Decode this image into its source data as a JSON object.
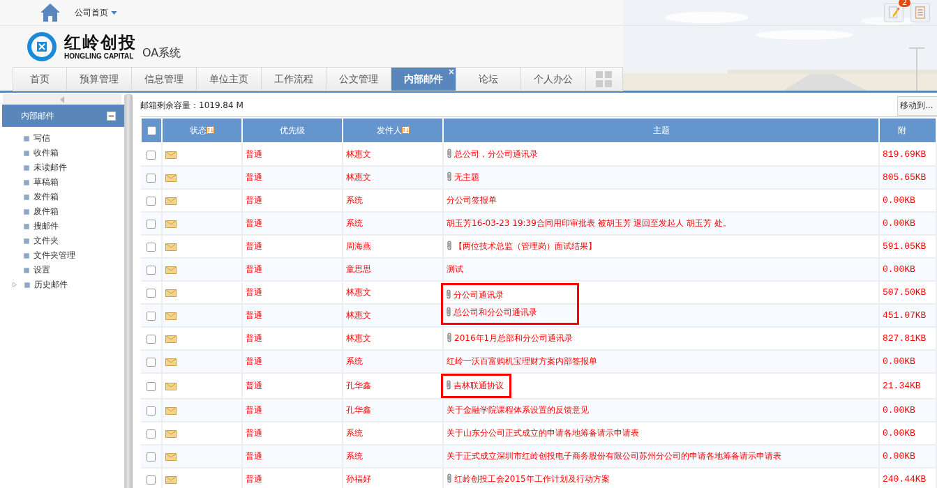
{
  "top_bar": {
    "home_menu": "公司首页",
    "notification_count": "2"
  },
  "brand": {
    "name": "红岭创投",
    "subtitle": "HONGLING CAPITAL",
    "system": "OA系统"
  },
  "tabs": [
    {
      "label": "首页",
      "selected": false
    },
    {
      "label": "预算管理",
      "selected": false
    },
    {
      "label": "信息管理",
      "selected": false
    },
    {
      "label": "单位主页",
      "selected": false
    },
    {
      "label": "工作流程",
      "selected": false
    },
    {
      "label": "公文管理",
      "selected": false
    },
    {
      "label": "内部邮件",
      "selected": true
    },
    {
      "label": "论坛",
      "selected": false
    },
    {
      "label": "个人办公",
      "selected": false
    }
  ],
  "sidebar": {
    "title": "内部邮件",
    "collapsed": false,
    "items": [
      {
        "label": "写信"
      },
      {
        "label": "收件箱"
      },
      {
        "label": "未读邮件"
      },
      {
        "label": "草稿箱"
      },
      {
        "label": "发件箱"
      },
      {
        "label": "废件箱"
      },
      {
        "label": "搜邮件"
      },
      {
        "label": "文件夹"
      },
      {
        "label": "文件夹管理"
      },
      {
        "label": "设置"
      },
      {
        "label": "历史邮件",
        "expanded": false
      }
    ]
  },
  "mailbox": {
    "capacity": "邮箱剩余容量：1019.84 M",
    "move_to": "移动到..."
  },
  "table": {
    "select_all_checked": false,
    "columns": [
      {
        "label": "状态",
        "sortable": true
      },
      {
        "label": "优先级",
        "sortable": false
      },
      {
        "label": "发件人",
        "sortable": true
      },
      {
        "label": "主题",
        "sortable": false
      },
      {
        "label": "附",
        "sortable": false
      }
    ],
    "rows": [
      {
        "checked": false,
        "priority": "普通",
        "sender": "林惠文",
        "attachment": true,
        "subject": "总公司，分公司通讯录",
        "size": "819.69KB",
        "marked": false
      },
      {
        "checked": false,
        "priority": "普通",
        "sender": "林惠文",
        "attachment": true,
        "subject": "无主题",
        "size": "805.65KB",
        "marked": false
      },
      {
        "checked": false,
        "priority": "普通",
        "sender": "系统",
        "attachment": false,
        "subject": "分公司签报单",
        "size": "0.00KB",
        "marked": false
      },
      {
        "checked": false,
        "priority": "普通",
        "sender": "系统",
        "attachment": false,
        "subject": "胡玉芳16-03-23 19:39合同用印审批表 被胡玉芳 退回至发起人 胡玉芳 处。",
        "size": "0.00KB",
        "marked": false
      },
      {
        "checked": false,
        "priority": "普通",
        "sender": "周海燕",
        "attachment": true,
        "subject": "【两位技术总监（管理岗）面试结果】",
        "size": "591.05KB",
        "marked": false
      },
      {
        "checked": false,
        "priority": "普通",
        "sender": "童思思",
        "attachment": false,
        "subject": "测试",
        "size": "0.00KB",
        "marked": false
      },
      {
        "checked": false,
        "priority": "普通",
        "sender": "林惠文",
        "attachment": true,
        "subject": "分公司通讯录",
        "size": "507.50KB",
        "marked": true
      },
      {
        "checked": false,
        "priority": "普通",
        "sender": "林惠文",
        "attachment": true,
        "subject": "总公司和分公司通讯录",
        "size": "451.07KB",
        "marked": true
      },
      {
        "checked": false,
        "priority": "普通",
        "sender": "林惠文",
        "attachment": true,
        "subject": "2016年1月总部和分公司通讯录",
        "size": "827.81KB",
        "marked": false
      },
      {
        "checked": false,
        "priority": "普通",
        "sender": "系统",
        "attachment": false,
        "subject": "红岭一沃百富购机宝理财方案内部签报单",
        "size": "0.00KB",
        "marked": false
      },
      {
        "checked": false,
        "priority": "普通",
        "sender": "孔华鑫",
        "attachment": true,
        "subject": "吉林联通协议",
        "size": "21.34KB",
        "marked": true
      },
      {
        "checked": false,
        "priority": "普通",
        "sender": "孔华鑫",
        "attachment": false,
        "subject": "关于金融学院课程体系设置的反馈意见",
        "size": "0.00KB",
        "marked": false
      },
      {
        "checked": false,
        "priority": "普通",
        "sender": "系统",
        "attachment": false,
        "subject": "关于山东分公司正式成立的申请各地筹备请示申请表",
        "size": "0.00KB",
        "marked": false
      },
      {
        "checked": false,
        "priority": "普通",
        "sender": "系统",
        "attachment": false,
        "subject": "关于正式成立深圳市红岭创投电子商务股份有限公司苏州分公司的申请各地筹备请示申请表",
        "size": "0.00KB",
        "marked": false
      },
      {
        "checked": false,
        "priority": "普通",
        "sender": "孙福好",
        "attachment": true,
        "subject": "红岭创投工会2015年工作计划及行动方案",
        "size": "240.44KB",
        "marked": false
      }
    ]
  }
}
